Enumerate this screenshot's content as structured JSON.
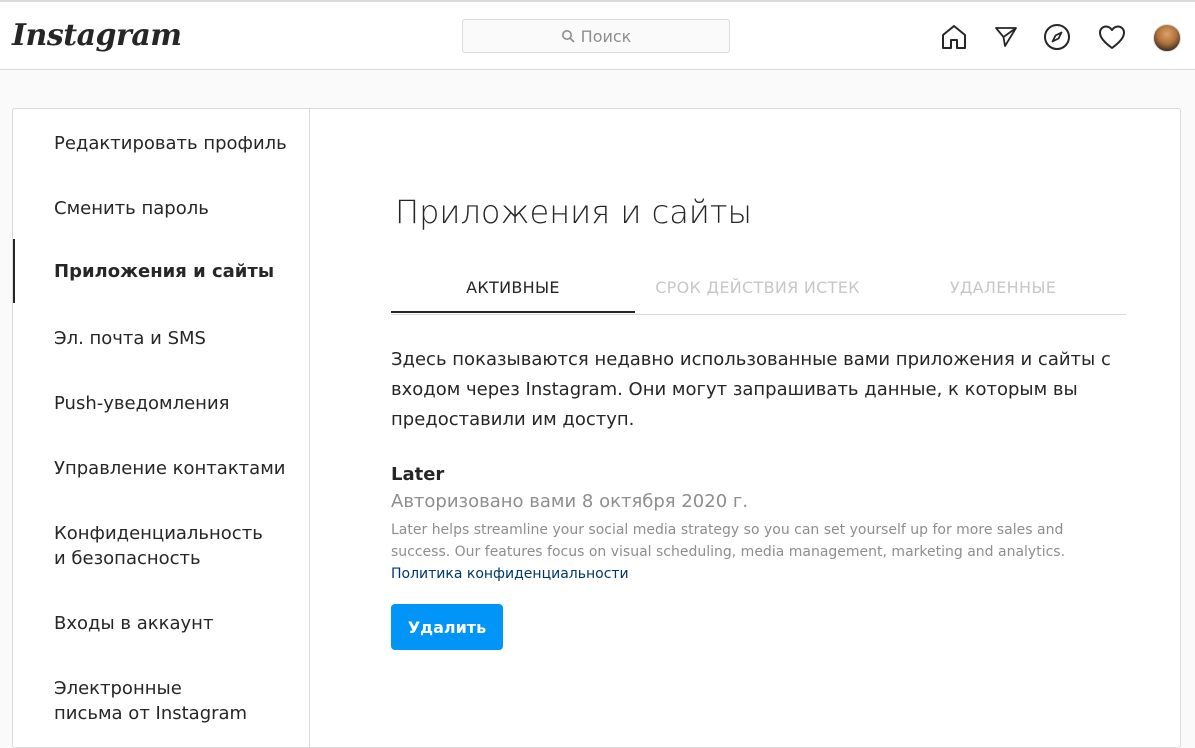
{
  "header": {
    "logo": "Instagram",
    "search_placeholder": "Поиск",
    "icons": [
      "home-icon",
      "direct-icon",
      "explore-icon",
      "activity-icon",
      "avatar"
    ]
  },
  "sidebar": {
    "items": [
      {
        "label": "Редактировать профиль"
      },
      {
        "label": "Сменить пароль"
      },
      {
        "label": "Приложения и сайты",
        "active": true
      },
      {
        "label": "Эл. почта и SMS"
      },
      {
        "label": "Push-уведомления"
      },
      {
        "label": "Управление контактами"
      },
      {
        "label": "Конфиденциальность и безопасность"
      },
      {
        "label": "Входы в аккаунт"
      },
      {
        "label": "Электронные письма от Instagram"
      }
    ]
  },
  "main": {
    "title": "Приложения и сайты",
    "tabs": [
      {
        "label": "АКТИВНЫЕ",
        "active": true
      },
      {
        "label": "СРОК ДЕЙСТВИЯ ИСТЕК"
      },
      {
        "label": "УДАЛЕННЫЕ"
      }
    ],
    "description": "Здесь показываются недавно использованные вами приложения и сайты с входом через Instagram. Они могут запрашивать данные, к которым вы предоставили им доступ.",
    "app": {
      "name": "Later",
      "authorized": "Авторизовано вами 8 октября 2020 г.",
      "description": "Later helps streamline your social media strategy so you can set yourself up for more sales and success. Our features focus on visual scheduling, media management, marketing and analytics.",
      "privacy_link": "Политика конфиденциальности",
      "delete_label": "Удалить"
    }
  },
  "colors": {
    "accent": "#0095f6",
    "link": "#00376b",
    "muted": "#8e8e8e"
  }
}
